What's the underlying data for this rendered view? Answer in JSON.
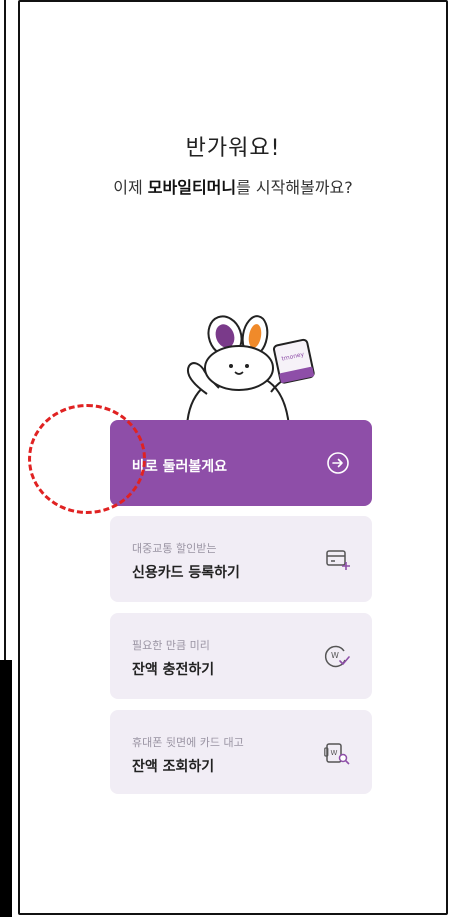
{
  "greeting": {
    "title": "반가워요!",
    "subtitle_prefix": "이제 ",
    "subtitle_brand": "모바일티머니",
    "subtitle_suffix": "를 시작해볼까요?"
  },
  "primary_action": {
    "label": "바로 둘러볼게요",
    "icon": "arrow-circle-right-icon"
  },
  "options": [
    {
      "small": "대중교통 할인받는",
      "label": "신용카드 등록하기",
      "icon": "card-plus-icon"
    },
    {
      "small": "필요한 만큼 미리",
      "label": "잔액 충전하기",
      "icon": "coin-check-icon"
    },
    {
      "small": "휴대폰 뒷면에 카드 대고",
      "label": "잔액 조회하기",
      "icon": "phone-search-icon"
    }
  ],
  "mascot": {
    "card_brand": "tmoney"
  },
  "colors": {
    "accent": "#8e4ea8",
    "card_bg": "#f1edf5",
    "annotation": "#e02222"
  }
}
